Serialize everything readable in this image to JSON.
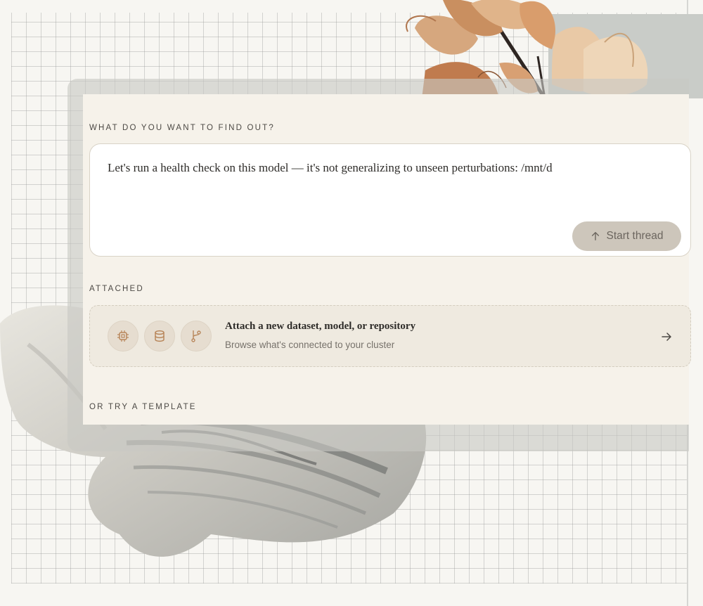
{
  "question_label": "WHAT DO YOU WANT TO FIND OUT?",
  "prompt": {
    "value": "Let's run a health check on this model — it's not generalizing to unseen perturbations: /mnt/d"
  },
  "start_button": {
    "label": "Start thread",
    "icon": "arrow-up-icon"
  },
  "attached_label": "ATTACHED",
  "attach": {
    "title": "Attach a new dataset, model, or repository",
    "subtitle": "Browse what's connected to your cluster",
    "icons": [
      "chip-icon",
      "database-icon",
      "git-branch-icon"
    ],
    "action_icon": "arrow-right-icon"
  },
  "template_label": "OR TRY A TEMPLATE",
  "colors": {
    "card_bg": "#f6f2ea",
    "accent_icon": "#b8865a",
    "button_bg": "#cdc6bb"
  }
}
